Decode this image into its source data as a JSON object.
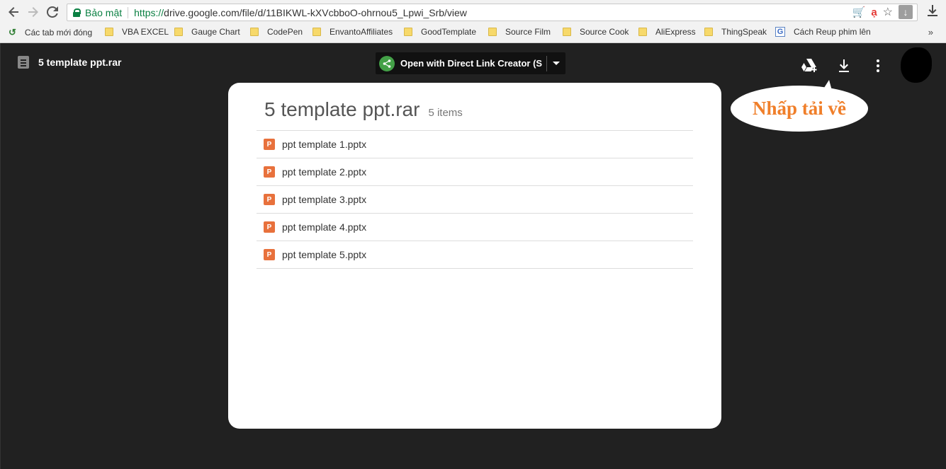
{
  "browser": {
    "secure_label": "Bảo mật",
    "url_scheme": "https://",
    "url_rest": "drive.google.com/file/d/11BIKWL-kXVcbboO-ohrnou5_Lpwi_Srb/view"
  },
  "bookmarks": {
    "items": [
      "Các tab mới đóng",
      "VBA EXCEL",
      "Gauge Chart",
      "CodePen",
      "EnvantoAffiliates",
      "GoodTemplate",
      "Source Film",
      "Source Cook",
      "AliExpress",
      "ThingSpeak",
      "Cách Reup phim lên"
    ],
    "more": "»"
  },
  "viewer": {
    "file_name": "5 template ppt.rar",
    "open_with_label": "Open with Direct Link Creator (Sh…"
  },
  "archive": {
    "title": "5 template ppt.rar",
    "count": "5 items",
    "files": [
      "ppt template 1.pptx",
      "ppt template 2.pptx",
      "ppt template 3.pptx",
      "ppt template 4.pptx",
      "ppt template 5.pptx"
    ],
    "file_icon_letter": "P"
  },
  "annotation": {
    "text": "Nhấp tải về"
  },
  "colors": {
    "secure_green": "#0b8043",
    "ppt_orange": "#e8713c",
    "callout_orange": "#f07f2a",
    "viewer_bg": "#212121"
  }
}
